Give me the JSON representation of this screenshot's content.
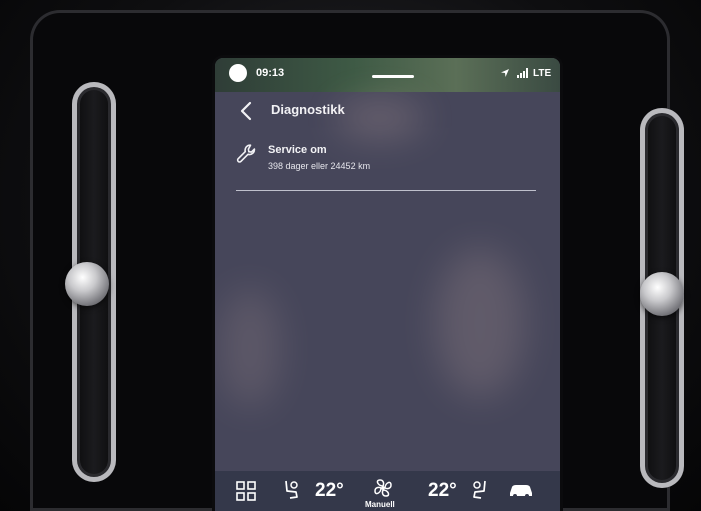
{
  "status_bar": {
    "time": "09:13",
    "network": "LTE"
  },
  "header": {
    "title": "Diagnostikk"
  },
  "service": {
    "title": "Service om",
    "detail": "398 dager eller 24452 km"
  },
  "climate_bar": {
    "left_temp": "22°",
    "right_temp": "22°",
    "fan_mode": "Manuell"
  },
  "colors": {
    "screen_bg": "#46465a",
    "climate_bg": "#34384a",
    "text": "#f2f2f5"
  }
}
